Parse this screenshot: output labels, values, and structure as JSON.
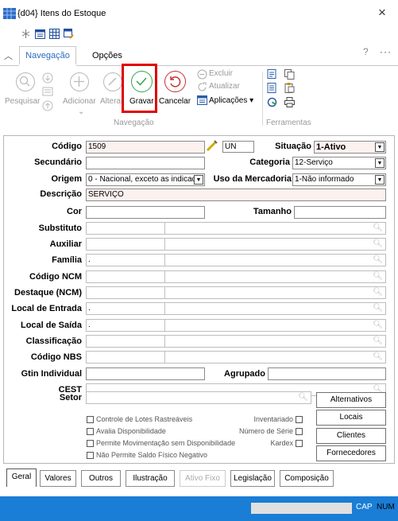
{
  "window": {
    "title": "{d04} Itens do Estoque",
    "close_glyph": "×"
  },
  "ribbon_tabs": {
    "nav": "Navegação",
    "options": "Opções",
    "help": "?",
    "more": "···"
  },
  "ribbon": {
    "pesquisar": "Pesquisar",
    "adicionar": "Adicionar",
    "alterar": "Alterar",
    "gravar": "Gravar",
    "cancelar": "Cancelar",
    "excluir": "Excluir",
    "atualizar": "Atualizar",
    "aplicacoes": "Aplicações ▾",
    "group_nav": "Navegação",
    "group_tools": "Ferramentas"
  },
  "form": {
    "codigo": {
      "label": "Código",
      "value": "1509",
      "unit": "UN"
    },
    "situacao": {
      "label": "Situação",
      "value": "1-Ativo"
    },
    "secundario": {
      "label": "Secundário",
      "value": ""
    },
    "categoria": {
      "label": "Categoria",
      "value": "12-Serviço"
    },
    "origem": {
      "label": "Origem",
      "value": "0 - Nacional, exceto as indicad"
    },
    "uso_mercadoria": {
      "label": "Uso da Mercadoria",
      "value": "1-Não informado"
    },
    "descricao": {
      "label": "Descrição",
      "value": "SERVIÇO"
    },
    "cor": {
      "label": "Cor",
      "value": ""
    },
    "tamanho": {
      "label": "Tamanho",
      "value": ""
    },
    "substituto": {
      "label": "Substituto",
      "value": ""
    },
    "auxiliar": {
      "label": "Auxiliar",
      "value": ""
    },
    "familia": {
      "label": "Família",
      "value": "."
    },
    "codigo_ncm": {
      "label": "Código NCM",
      "value": ""
    },
    "destaque_ncm": {
      "label": "Destaque (NCM)",
      "value": ""
    },
    "local_entrada": {
      "label": "Local de Entrada",
      "value": "."
    },
    "local_saida": {
      "label": "Local de Saída",
      "value": "."
    },
    "classificacao": {
      "label": "Classificação",
      "value": ""
    },
    "codigo_nbs": {
      "label": "Código NBS",
      "value": ""
    },
    "gtin": {
      "label": "Gtin Individual",
      "value": ""
    },
    "agrupado": {
      "label": "Agrupado",
      "value": ""
    },
    "cest": {
      "label": "CEST",
      "value": ""
    },
    "setor": {
      "label": "Setor",
      "value": ""
    }
  },
  "checks": {
    "lotes": "Controle de Lotes Rastreáveis",
    "avalia": "Avalia Disponibilidade",
    "permite_mov": "Permite Movimentação sem Disponibilidade",
    "nao_permite": "Não Permite Saldo Físico Negativo",
    "inventariado": "Inventariado",
    "numero_serie": "Número de Série",
    "kardex": "Kardex"
  },
  "buttons": {
    "alternativos": "Alternativos",
    "locais": "Locais",
    "clientes": "Clientes",
    "fornecedores": "Fornecedores"
  },
  "bottom_tabs": [
    "Geral",
    "Valores",
    "Outros",
    "Ilustração",
    "Ativo Fixo",
    "Legislação",
    "Composição"
  ],
  "status": {
    "cap": "CAP",
    "num": "NUM"
  }
}
